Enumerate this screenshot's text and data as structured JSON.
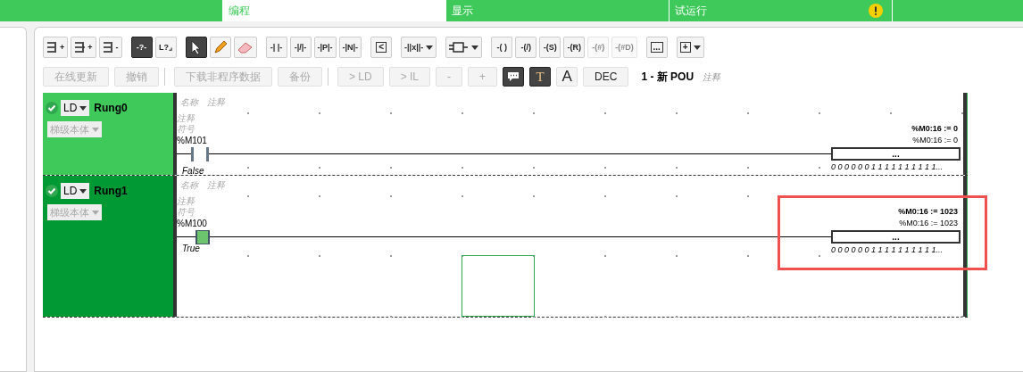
{
  "tabs": [
    {
      "selected": false,
      "warning": false
    },
    {
      "label": "编程",
      "selected": true,
      "warning": false
    },
    {
      "label": "显示",
      "selected": false,
      "warning": false
    },
    {
      "label": "试运行",
      "selected": false,
      "warning": true
    }
  ],
  "toolbar": [
    {
      "items": [
        {
          "kind": "rung-add",
          "glyph": "+",
          "pressed": false,
          "disabled": false,
          "dropdown": false
        },
        {
          "kind": "rung-branch",
          "glyph": "+",
          "pressed": false,
          "disabled": false,
          "dropdown": false
        },
        {
          "kind": "rung-delete",
          "glyph": "-",
          "pressed": false,
          "disabled": false,
          "dropdown": false
        }
      ]
    },
    {
      "items": [
        {
          "kind": "text",
          "glyph": "-?-",
          "pressed": true,
          "disabled": false,
          "dropdown": false
        },
        {
          "kind": "text",
          "glyph": "L?⌟",
          "pressed": false,
          "disabled": false,
          "dropdown": false
        }
      ]
    },
    {
      "items": [
        {
          "kind": "pointer",
          "pressed": true,
          "disabled": false,
          "dropdown": false
        },
        {
          "kind": "pencil",
          "pressed": false,
          "disabled": false,
          "dropdown": false
        },
        {
          "kind": "eraser",
          "pressed": false,
          "disabled": false,
          "dropdown": false
        }
      ]
    },
    {
      "items": [
        {
          "kind": "text",
          "glyph": "-| |-",
          "pressed": false,
          "disabled": false,
          "dropdown": false
        },
        {
          "kind": "text",
          "glyph": "-|/|-",
          "pressed": false,
          "disabled": false,
          "dropdown": false
        },
        {
          "kind": "text",
          "glyph": "-|P|-",
          "pressed": false,
          "disabled": false,
          "dropdown": false
        },
        {
          "kind": "text",
          "glyph": "-|N|-",
          "pressed": false,
          "disabled": false,
          "dropdown": false
        }
      ]
    },
    {
      "items": [
        {
          "kind": "framed",
          "glyph": "<",
          "pressed": false,
          "disabled": false,
          "dropdown": false
        }
      ]
    },
    {
      "items": [
        {
          "kind": "text",
          "glyph": "-||x||-",
          "pressed": false,
          "disabled": false,
          "dropdown": true
        }
      ]
    },
    {
      "items": [
        {
          "kind": "block",
          "pressed": false,
          "disabled": false,
          "dropdown": true
        }
      ]
    },
    {
      "items": [
        {
          "kind": "text",
          "glyph": "-( )",
          "pressed": false,
          "disabled": false,
          "dropdown": false
        },
        {
          "kind": "text",
          "glyph": "-(/)",
          "pressed": false,
          "disabled": false,
          "dropdown": false
        },
        {
          "kind": "text",
          "glyph": "-(S)",
          "pressed": false,
          "disabled": false,
          "dropdown": false
        },
        {
          "kind": "text",
          "glyph": "-(R)",
          "pressed": false,
          "disabled": false,
          "dropdown": false
        },
        {
          "kind": "text",
          "glyph": "-(#)",
          "pressed": false,
          "disabled": true,
          "dropdown": false
        },
        {
          "kind": "text",
          "glyph": "-(#D)",
          "pressed": false,
          "disabled": true,
          "dropdown": false
        }
      ]
    },
    {
      "items": [
        {
          "kind": "framed",
          "glyph": "...",
          "pressed": false,
          "disabled": false,
          "dropdown": false
        }
      ]
    },
    {
      "items": [
        {
          "kind": "framed",
          "glyph": "+",
          "pressed": false,
          "disabled": false,
          "dropdown": true
        }
      ]
    }
  ],
  "actions": [
    {
      "items": [
        {
          "kind": "button",
          "label": "在线更新",
          "pressed": false,
          "disabled": true
        },
        {
          "kind": "button",
          "label": "撤销",
          "pressed": false,
          "disabled": true
        }
      ]
    },
    {
      "items": [
        {
          "kind": "separator"
        },
        {
          "kind": "button",
          "label": "下载非程序数据",
          "pressed": false,
          "disabled": true
        },
        {
          "kind": "button",
          "label": "备份",
          "pressed": false,
          "disabled": true
        }
      ]
    },
    {
      "items": [
        {
          "kind": "separator"
        },
        {
          "kind": "button",
          "label": "> LD",
          "pressed": false,
          "disabled": true
        },
        {
          "kind": "button",
          "label": "> IL",
          "pressed": false,
          "disabled": true
        }
      ]
    },
    {
      "items": [
        {
          "kind": "button",
          "label": "-",
          "pressed": false,
          "disabled": true
        },
        {
          "kind": "button",
          "label": "+",
          "pressed": false,
          "disabled": true
        }
      ]
    },
    {
      "items": [
        {
          "kind": "comment",
          "pressed": true,
          "disabled": false
        },
        {
          "kind": "glyph",
          "label": "T",
          "pressed": true,
          "disabled": false
        },
        {
          "kind": "font",
          "label": "A",
          "pressed": false,
          "disabled": false
        },
        {
          "kind": "button",
          "label": "DEC",
          "pressed": false,
          "disabled": false
        }
      ]
    }
  ],
  "pou": {
    "title": "1 - 新 POU",
    "comment": "注释"
  },
  "rungs": [
    {
      "name": "Rung0",
      "language": "LD",
      "valid": true,
      "selected": false,
      "body": "梯级本体",
      "name_label": "名称",
      "comment_label": "注释",
      "line_comment": "注释",
      "symbol": "符号",
      "address": "%M101",
      "state": "False",
      "energized": false,
      "cursor": false,
      "output": {
        "title": "%M0:16 := 0",
        "value": "%M0:16 := 0",
        "box": "...",
        "bits": "0 0 0 0 0 0 1 1 1 1 1 1 1 1 1 1..."
      }
    },
    {
      "name": "Rung1",
      "language": "LD",
      "valid": true,
      "selected": true,
      "body": "梯级本体",
      "name_label": "名称",
      "comment_label": "注释",
      "line_comment": "注释",
      "symbol": "符号",
      "address": "%M100",
      "state": "True",
      "energized": true,
      "cursor": true,
      "output": {
        "title": "%M0:16 := 1023",
        "value": "%M0:16 := 1023",
        "box": "...",
        "bits": "0 0 0 0 0 0 1 1 1 1 1 1 1 1 1 1..."
      }
    }
  ],
  "highlight": {
    "shown": true
  }
}
